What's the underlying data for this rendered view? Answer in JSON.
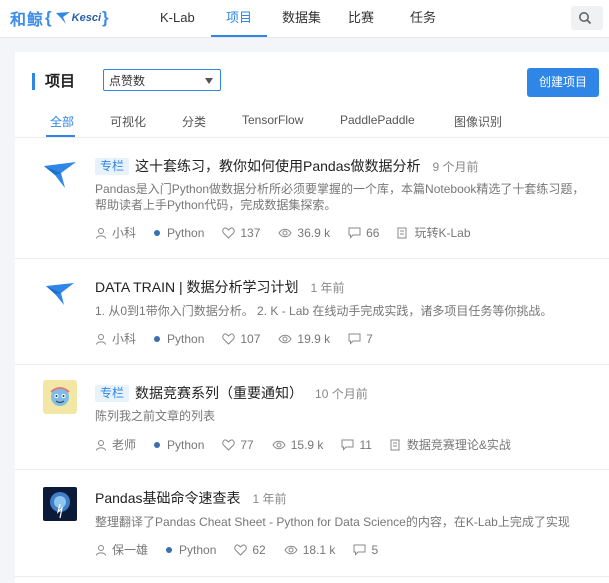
{
  "brand": {
    "cn": "和鲸",
    "en": "Kesci"
  },
  "nav": [
    "K-Lab",
    "项目",
    "数据集",
    "比赛",
    "任务"
  ],
  "page_title": "项目",
  "sort_value": "点赞数",
  "create_label": "创建项目",
  "tabs": [
    "全部",
    "可视化",
    "分类",
    "TensorFlow",
    "PaddlePaddle",
    "图像识别"
  ],
  "items": [
    {
      "tag": "专栏",
      "title": "这十套练习，教你如何使用Pandas做数据分析",
      "time": "9 个月前",
      "desc": "Pandas是入门Python做数据分析所必须要掌握的一个库，本篇Notebook精选了十套练习题，帮助读者上手Python代码，完成数据集探索。",
      "author": "小科",
      "lang": "Python",
      "likes": "137",
      "views": "36.9 k",
      "comments": "66",
      "dataset": "玩转K-Lab"
    },
    {
      "title": "DATA TRAIN | 数据分析学习计划",
      "time": "1 年前",
      "desc": "1. 从0到1带你入门数据分析。 2. K - Lab 在线动手完成实践，诸多项目任务等你挑战。",
      "author": "小科",
      "lang": "Python",
      "likes": "107",
      "views": "19.9 k",
      "comments": "7"
    },
    {
      "tag": "专栏",
      "title": "数据竞赛系列（重要通知）",
      "time": "10 个月前",
      "desc": "陈列我之前文章的列表",
      "author": "老师",
      "lang": "Python",
      "likes": "77",
      "views": "15.9 k",
      "comments": "11",
      "dataset": "数据竞赛理论&实战"
    },
    {
      "title": "Pandas基础命令速查表",
      "time": "1 年前",
      "desc": "整理翻译了Pandas Cheat Sheet - Python for Data Science的内容，在K-Lab上完成了实现",
      "author": "保一雄",
      "lang": "Python",
      "likes": "62",
      "views": "18.1 k",
      "comments": "5"
    }
  ],
  "colors": {
    "accent": "#2f86e6",
    "lang_dot": "#3a6fb5"
  }
}
